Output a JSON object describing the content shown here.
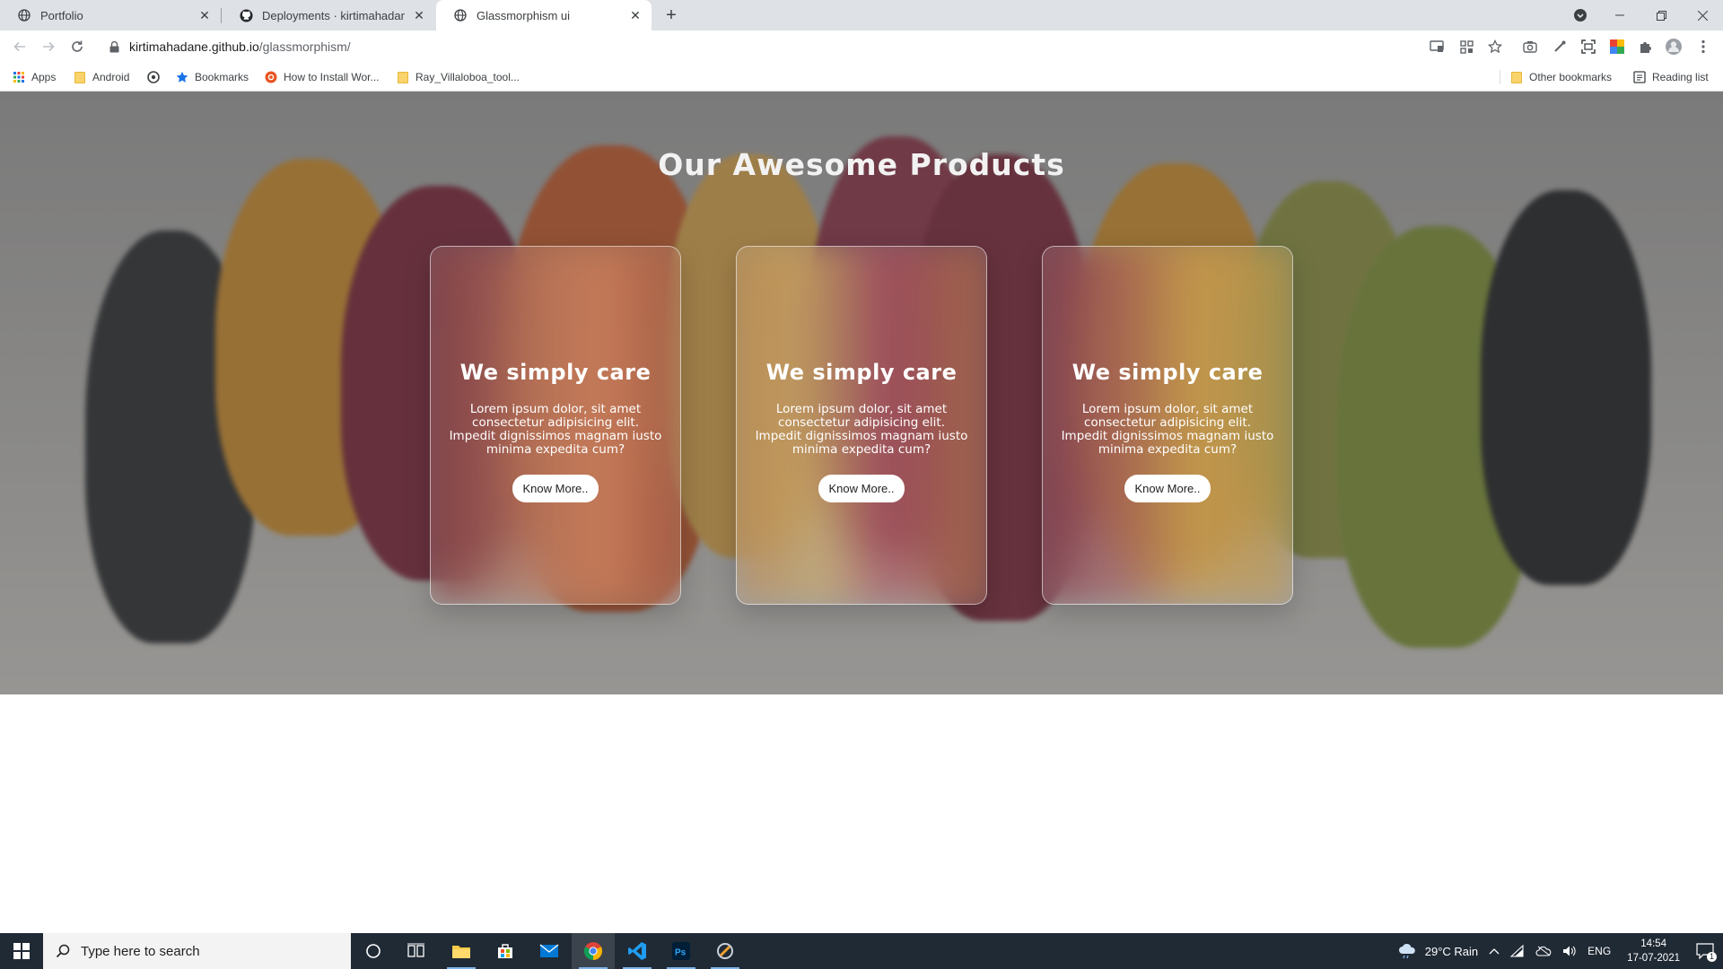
{
  "browser": {
    "tabs": [
      {
        "title": "Portfolio",
        "icon": "globe-icon",
        "active": false
      },
      {
        "title": "Deployments · kirtimahadane/gla",
        "icon": "github-icon",
        "active": false
      },
      {
        "title": "Glassmorphism ui",
        "icon": "globe-icon",
        "active": true
      }
    ],
    "url_host": "kirtimahadane.github.io",
    "url_path": "/glassmorphism/",
    "bookmarks": [
      {
        "label": "Apps",
        "icon": "apps-grid-icon"
      },
      {
        "label": "Android",
        "icon": "folder-icon"
      },
      {
        "label": "",
        "icon": "chrome-web-icon"
      },
      {
        "label": "Bookmarks",
        "icon": "star-icon"
      },
      {
        "label": "How to Install Wor...",
        "icon": "ubuntu-icon"
      },
      {
        "label": "Ray_Villaloboa_tool...",
        "icon": "folder-icon"
      }
    ],
    "other_bookmarks": "Other bookmarks",
    "reading_list": "Reading list"
  },
  "page": {
    "title": "Our Awesome Products",
    "cards": [
      {
        "heading": "We simply care",
        "body": "Lorem ipsum dolor, sit amet consectetur adipisicing elit. Impedit dignissimos magnam iusto minima expedita cum?",
        "button": "Know More.."
      },
      {
        "heading": "We simply care",
        "body": "Lorem ipsum dolor, sit amet consectetur adipisicing elit. Impedit dignissimos magnam iusto minima expedita cum?",
        "button": "Know More.."
      },
      {
        "heading": "We simply care",
        "body": "Lorem ipsum dolor, sit amet consectetur adipisicing elit. Impedit dignissimos magnam iusto minima expedita cum?",
        "button": "Know More.."
      }
    ]
  },
  "taskbar": {
    "search_placeholder": "Type here to search",
    "weather": "29°C  Rain",
    "language": "ENG",
    "time": "14:54",
    "date": "17-07-2021",
    "notification_count": "1"
  }
}
